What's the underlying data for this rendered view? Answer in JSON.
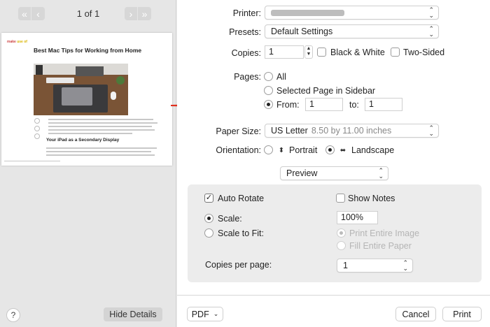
{
  "preview": {
    "page_counter": "1 of 1",
    "nav_first_icon": "«",
    "nav_prev_icon": "‹",
    "nav_next_icon": "›",
    "nav_last_icon": "»",
    "help_label": "?",
    "hide_details_label": "Hide Details",
    "thumbnail": {
      "logo_part1": "make",
      "logo_part2": "use of",
      "title": "Best Mac Tips for Working from Home",
      "subtitle": "Your iPad as a Secondary Display"
    }
  },
  "print": {
    "printer_label": "Printer:",
    "printer_value": "",
    "presets_label": "Presets:",
    "presets_value": "Default Settings",
    "copies_label": "Copies:",
    "copies_value": "1",
    "bw_label": "Black & White",
    "two_sided_label": "Two-Sided",
    "pages_label": "Pages:",
    "pages_all": "All",
    "pages_selected": "Selected Page in Sidebar",
    "pages_from_label": "From:",
    "pages_from_value": "1",
    "pages_to_label": "to:",
    "pages_to_value": "1",
    "paper_size_label": "Paper Size:",
    "paper_size_value": "US Letter",
    "paper_size_dims": "8.50 by 11.00 inches",
    "orientation_label": "Orientation:",
    "orientation_portrait": "Portrait",
    "orientation_landscape": "Landscape",
    "section_popup_value": "Preview",
    "auto_rotate_label": "Auto Rotate",
    "show_notes_label": "Show Notes",
    "scale_label": "Scale:",
    "scale_value": "100%",
    "scale_to_fit_label": "Scale to Fit:",
    "print_entire_image": "Print Entire Image",
    "fill_entire_paper": "Fill Entire Paper",
    "copies_per_page_label": "Copies per page:",
    "copies_per_page_value": "1",
    "pdf_label": "PDF",
    "cancel_label": "Cancel",
    "print_label": "Print"
  },
  "colors": {
    "arrow": "#e0301e"
  }
}
